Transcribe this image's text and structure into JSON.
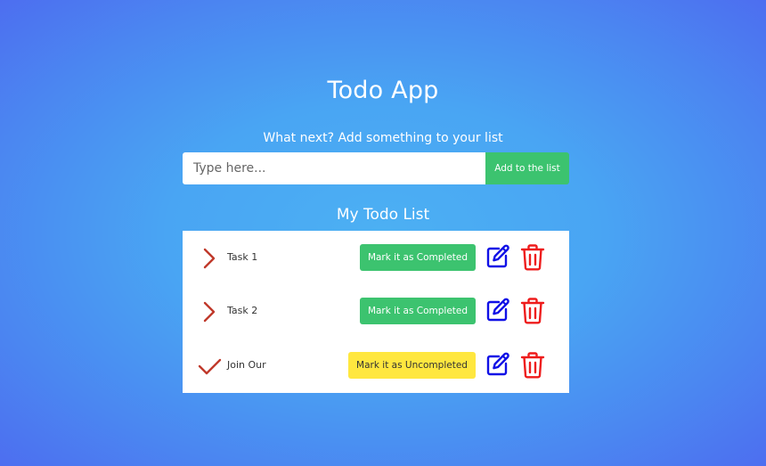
{
  "app": {
    "title": "Todo App"
  },
  "form": {
    "prompt": "What next? Add something to your list",
    "input_placeholder": "Type here...",
    "input_value": "",
    "add_button_label": "Add to the list"
  },
  "list": {
    "heading": "My Todo List",
    "items": [
      {
        "label": "Task 1",
        "completed": false,
        "status_icon": "chevron-right-icon",
        "action_label": "Mark it as Completed"
      },
      {
        "label": "Task 2",
        "completed": false,
        "status_icon": "chevron-right-icon",
        "action_label": "Mark it as Completed"
      },
      {
        "label": "Join Our",
        "completed": true,
        "status_icon": "checkmark-icon",
        "action_label": "Mark it as Uncompleted"
      }
    ]
  },
  "colors": {
    "green_button": "#3cc36f",
    "yellow_button": "#ffe73f",
    "edit_icon": "#1010e6",
    "delete_icon": "#ee1c1c",
    "status_icon": "#c0392b"
  }
}
